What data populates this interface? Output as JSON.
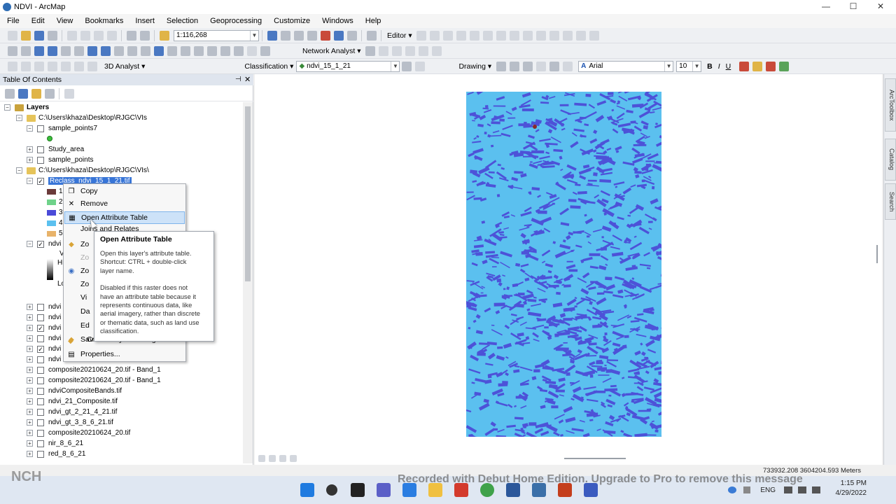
{
  "window": {
    "title": "NDVI - ArcMap",
    "minimize": "—",
    "maximize": "☐",
    "close": "✕"
  },
  "menu": [
    "File",
    "Edit",
    "View",
    "Bookmarks",
    "Insert",
    "Selection",
    "Geoprocessing",
    "Customize",
    "Windows",
    "Help"
  ],
  "toolbar1": {
    "scale": "1:116,268",
    "editor": "Editor ▾"
  },
  "toolbar2": {
    "network_analyst": "Network Analyst ▾"
  },
  "toolbar3": {
    "analyst3d": "3D Analyst ▾",
    "classification": "Classification ▾",
    "layer_select": "ndvi_15_1_21",
    "drawing": "Drawing ▾",
    "font_name": "Arial",
    "font_size": "10",
    "bold": "B",
    "italic": "I",
    "underline": "U"
  },
  "toc": {
    "title": "Table Of Contents",
    "rows": [
      {
        "label": "Layers"
      },
      {
        "label": "C:\\Users\\khaza\\Desktop\\RJGC\\VIs"
      },
      {
        "label": "sample_points7"
      },
      {
        "label": "Study_area"
      },
      {
        "label": "sample_points"
      },
      {
        "label": "C:\\Users\\khaza\\Desktop\\RJGC\\VIs\\"
      },
      {
        "label": "Reclass_ndvi_15_1_21.tif"
      },
      {
        "label": "1"
      },
      {
        "label": "2"
      },
      {
        "label": "3"
      },
      {
        "label": "4"
      },
      {
        "label": "5"
      },
      {
        "label": "ndvi"
      },
      {
        "label": "V"
      },
      {
        "label": "Hi"
      },
      {
        "label": "Lo"
      },
      {
        "label": "ndvi"
      },
      {
        "label": "ndvi"
      },
      {
        "label": "ndvi"
      },
      {
        "label": "ndvi"
      },
      {
        "label": "ndvi"
      },
      {
        "label": "ndvi"
      },
      {
        "label": "composite20210624_20.tif - Band_1"
      },
      {
        "label": "composite20210624_20.tif - Band_1"
      },
      {
        "label": "ndviCompositeBands.tif"
      },
      {
        "label": "ndvi_21_Composite.tif"
      },
      {
        "label": "ndvi_gt_2_21_4_21.tif"
      },
      {
        "label": "ndvi_gt_3_8_6_21.tif"
      },
      {
        "label": "composite20210624_20.tif"
      },
      {
        "label": "nir_8_6_21"
      },
      {
        "label": "red_8_6_21"
      }
    ],
    "class_colors": [
      "#6b3a3a",
      "#6fd28a",
      "#4a4ad8",
      "#5bc0ef",
      "#e8b36a"
    ]
  },
  "context_menu": {
    "items": [
      "Copy",
      "Remove",
      "Open Attribute Table",
      "Joins and Relates",
      "Zo",
      "Zo",
      "Zo",
      "Zo",
      "Vi",
      "Da",
      "Ed",
      "Sav",
      "Create Layer Package...",
      "Properties..."
    ],
    "selected": "Open Attribute Table"
  },
  "tooltip": {
    "title": "Open Attribute Table",
    "lines": [
      "Open this layer's attribute table.",
      "Shortcut: CTRL + double-click",
      "layer name.",
      "",
      "Disabled if this raster does not",
      "have an attribute table because it",
      "represents continuous data, like",
      "aerial imagery, rather than discrete",
      "or thematic data, such as land use",
      "classification."
    ]
  },
  "map": {
    "background": "#5bc0ef",
    "feature_color": "#4d52d8"
  },
  "status": {
    "coordinates": "733932.208  3604204.593 Meters"
  },
  "side_tabs": [
    "ArcToolbox",
    "Catalog",
    "Search"
  ],
  "watermark": "Recorded with Debut Home Edition. Upgrade to Pro to remove this message",
  "nch": "NCH",
  "tray": {
    "lang": "ENG",
    "time": "1:15 PM",
    "date": "4/29/2022"
  }
}
